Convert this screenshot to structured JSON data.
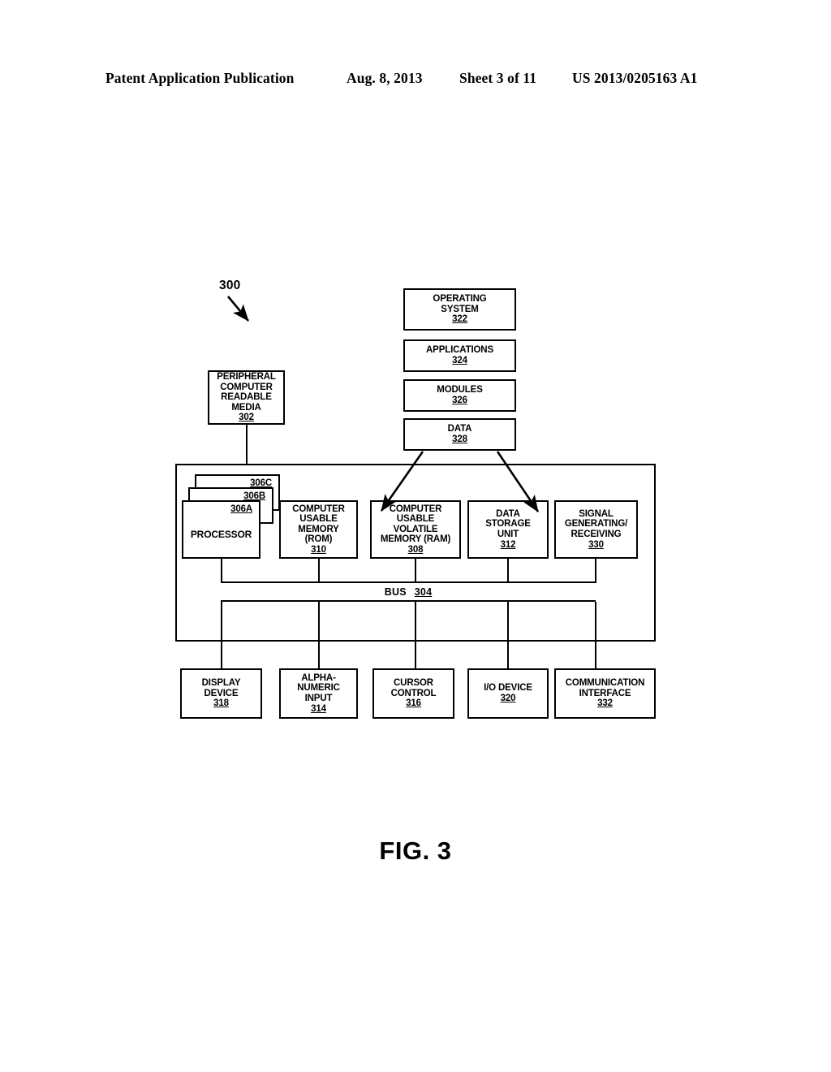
{
  "header": {
    "publication": "Patent Application Publication",
    "date": "Aug. 8, 2013",
    "sheet": "Sheet 3 of 11",
    "patent_number": "US 2013/0205163 A1"
  },
  "figure": {
    "caption": "FIG. 3",
    "system_callout": "300",
    "peripheral": {
      "line1": "PERIPHERAL",
      "line2": "COMPUTER",
      "line3": "READABLE",
      "line4": "MEDIA",
      "ref": "302"
    },
    "software_stack": [
      {
        "lines": [
          "OPERATING",
          "SYSTEM"
        ],
        "ref": "322"
      },
      {
        "lines": [
          "APPLICATIONS"
        ],
        "ref": "324"
      },
      {
        "lines": [
          "MODULES"
        ],
        "ref": "326"
      },
      {
        "lines": [
          "DATA"
        ],
        "ref": "328"
      }
    ],
    "processor": {
      "label": "PROCESSOR",
      "ref_front": "306A",
      "ref_middle": "306B",
      "ref_back": "306C"
    },
    "components": [
      {
        "lines": [
          "COMPUTER",
          "USABLE",
          "MEMORY",
          "(ROM)"
        ],
        "ref": "310"
      },
      {
        "lines": [
          "COMPUTER",
          "USABLE",
          "VOLATILE",
          "MEMORY (RAM)"
        ],
        "ref": "308"
      },
      {
        "lines": [
          "DATA",
          "STORAGE",
          "UNIT"
        ],
        "ref": "312"
      },
      {
        "lines": [
          "SIGNAL",
          "GENERATING/",
          "RECEIVING"
        ],
        "ref": "330"
      }
    ],
    "bus": {
      "label": "BUS",
      "ref": "304"
    },
    "peripherals": [
      {
        "lines": [
          "DISPLAY",
          "DEVICE"
        ],
        "ref": "318"
      },
      {
        "lines": [
          "ALPHA-",
          "NUMERIC",
          "INPUT"
        ],
        "ref": "314"
      },
      {
        "lines": [
          "CURSOR",
          "CONTROL"
        ],
        "ref": "316"
      },
      {
        "lines": [
          "I/O DEVICE"
        ],
        "ref": "320"
      },
      {
        "lines": [
          "COMMUNICATION",
          "INTERFACE"
        ],
        "ref": "332"
      }
    ]
  },
  "colors": {
    "ink": "#000000",
    "paper": "#ffffff"
  }
}
